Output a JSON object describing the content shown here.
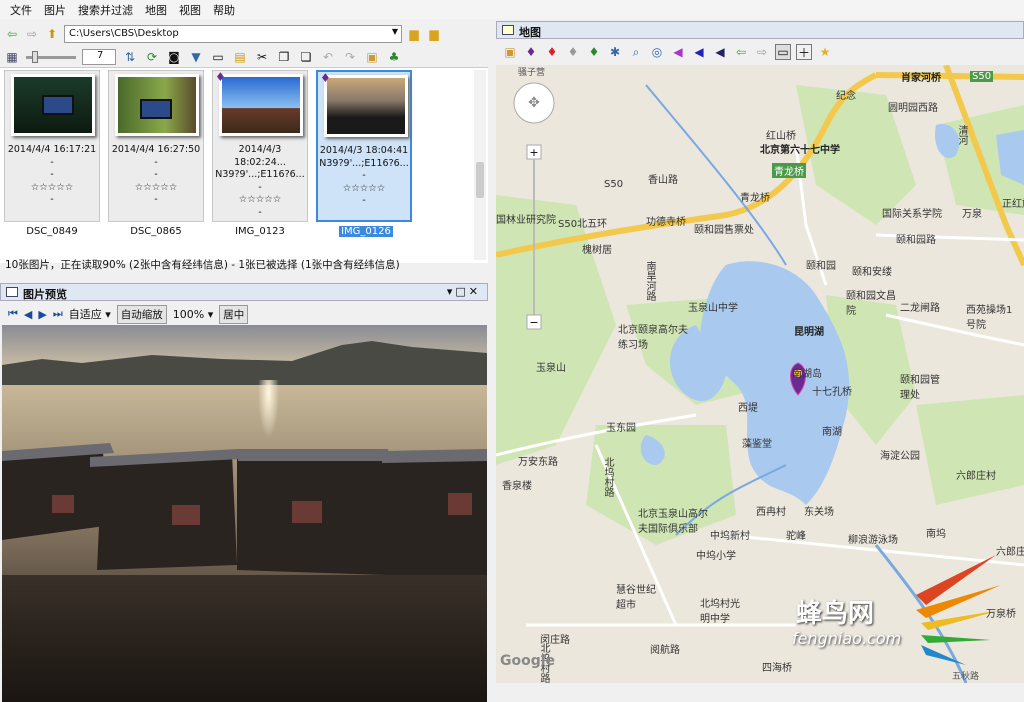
{
  "menu": [
    "文件",
    "图片",
    "搜索并过滤",
    "地图",
    "视图",
    "帮助"
  ],
  "path": "C:\\Users\\CBS\\Desktop",
  "thumb_size": "7",
  "thumbnails": [
    {
      "date": "2014/4/4 16:17:21",
      "coords": "-",
      "dash": "-",
      "stars": "☆☆☆☆☆",
      "extra": "-",
      "name": "DSC_0849"
    },
    {
      "date": "2014/4/4 16:27:50",
      "coords": "-",
      "dash": "-",
      "stars": "☆☆☆☆☆",
      "extra": "-",
      "name": "DSC_0865"
    },
    {
      "date": "2014/4/3 18:02:24...",
      "coords": "N39?9'...;E116?6...",
      "dash": "-",
      "stars": "☆☆☆☆☆",
      "extra": "-",
      "name": "IMG_0123"
    },
    {
      "date": "2014/4/3 18:04:41",
      "coords": "N39?9'...;E116?6...",
      "dash": "-",
      "stars": "☆☆☆☆☆",
      "extra": "-",
      "name": "IMG_0126"
    }
  ],
  "status": "10张图片，正在读取90% (2张中含有经纬信息) - 1张已被选择 (1张中含有经纬信息)",
  "preview": {
    "title": "图片预览",
    "fit": "自适应",
    "auto_zoom": "自动缩放",
    "zoom": "100%",
    "center": "居中"
  },
  "map": {
    "title": "地图",
    "labels": [
      "肖家河桥",
      "S50",
      "骚子营",
      "圆明园西路",
      "清河",
      "纪念",
      "正红旗",
      "红山桥",
      "北京第六十七中学",
      "香山路",
      "S50",
      "青龙桥",
      "S50北五环",
      "功德寺桥",
      "青龙桥",
      "国际关系学院",
      "万泉",
      "颐和园路",
      "国林业研究院",
      "槐树居",
      "颐和园售票处",
      "颐和园",
      "颐和安缕",
      "南旱河路",
      "颐和园文昌院",
      "二龙闸路",
      "西苑操场1号院",
      "北京颐泉高尔夫练习场",
      "玉泉山中学",
      "昆明湖",
      "南湖岛",
      "十七孔桥",
      "玉泉山",
      "西堤",
      "南湖",
      "颐和园管理处",
      "玉东园",
      "藻鉴堂",
      "海淀公园",
      "万安东路",
      "六郎庄村",
      "香泉楼",
      "北坞村路",
      "北京玉泉山高尔夫国际俱乐部",
      "中坞新村",
      "中坞小学",
      "东关场",
      "柳浪游泳场",
      "南坞",
      "西冉村",
      "驼峰",
      "六郎庄",
      "慧谷世纪超市",
      "北坞村光明中学",
      "四海桥",
      "万泉桥",
      "闵庄路",
      "北坞村路",
      "阅航路",
      "蜂鸟网",
      "fengniao.com",
      "Google",
      "五秋路"
    ],
    "marker_color": "#6a2a90"
  }
}
